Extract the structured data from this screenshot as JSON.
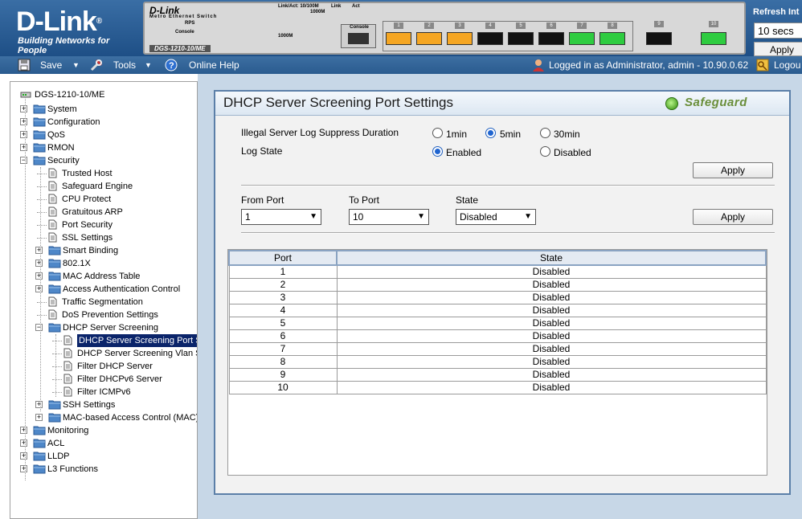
{
  "banner": {
    "brand": "D-Link",
    "tagline": "Building Networks for People",
    "device": {
      "brand": "D-Link",
      "subtitle": "Metro Ethernet Switch",
      "model": "DGS-1210-10/ME",
      "legend_line1": "Link/Act: 10/100M",
      "legend_line2": "1000M",
      "legend_link": "Link",
      "legend_act": "Act",
      "rps_label": "RPS",
      "console_label": "Console",
      "console_port_label": "Console",
      "gig_label": "1000M",
      "port_numbers": [
        "1",
        "2",
        "3",
        "4",
        "5",
        "6",
        "7",
        "8",
        "9",
        "10"
      ],
      "port_colors": [
        "amber",
        "amber",
        "amber",
        "black",
        "black",
        "black",
        "green",
        "green",
        "black",
        "green"
      ]
    },
    "refresh": {
      "label": "Refresh Int",
      "value": "10 secs",
      "apply": "Apply"
    }
  },
  "toolbar": {
    "save": "Save",
    "tools": "Tools",
    "help": "Online Help",
    "login_status": "Logged in as Administrator, admin - 10.90.0.62",
    "logout": "Logou"
  },
  "tree": {
    "root": "DGS-1210-10/ME",
    "items": [
      {
        "label": "System"
      },
      {
        "label": "Configuration"
      },
      {
        "label": "QoS"
      },
      {
        "label": "RMON"
      },
      {
        "label": "Security"
      },
      {
        "label": "Trusted Host"
      },
      {
        "label": "Safeguard Engine"
      },
      {
        "label": "CPU Protect"
      },
      {
        "label": "Gratuitous ARP"
      },
      {
        "label": "Port Security"
      },
      {
        "label": "SSL Settings"
      },
      {
        "label": "Smart Binding"
      },
      {
        "label": "802.1X"
      },
      {
        "label": "MAC Address Table"
      },
      {
        "label": "Access Authentication Control"
      },
      {
        "label": "Traffic Segmentation"
      },
      {
        "label": "DoS Prevention Settings"
      },
      {
        "label": "DHCP Server Screening"
      },
      {
        "label": "DHCP Server Screening Port S"
      },
      {
        "label": "DHCP Server Screening Vlan S"
      },
      {
        "label": "Filter DHCP Server"
      },
      {
        "label": "Filter DHCPv6 Server"
      },
      {
        "label": "Filter ICMPv6"
      },
      {
        "label": "SSH Settings"
      },
      {
        "label": "MAC-based Access Control (MAC)"
      },
      {
        "label": "Monitoring"
      },
      {
        "label": "ACL"
      },
      {
        "label": "LLDP"
      },
      {
        "label": "L3 Functions"
      }
    ]
  },
  "main": {
    "title": "DHCP Server Screening Port Settings",
    "safeguard": "Safeguard",
    "suppress": {
      "label": "Illegal Server Log Suppress Duration",
      "options": [
        "1min",
        "5min",
        "30min"
      ],
      "selected": "5min"
    },
    "log_state": {
      "label": "Log State",
      "options": [
        "Enabled",
        "Disabled"
      ],
      "selected": "Enabled"
    },
    "apply_top": "Apply",
    "from_port": {
      "label": "From Port",
      "value": "1"
    },
    "to_port": {
      "label": "To Port",
      "value": "10"
    },
    "state": {
      "label": "State",
      "value": "Disabled"
    },
    "apply_mid": "Apply",
    "table": {
      "headers": [
        "Port",
        "State"
      ],
      "rows": [
        [
          "1",
          "Disabled"
        ],
        [
          "2",
          "Disabled"
        ],
        [
          "3",
          "Disabled"
        ],
        [
          "4",
          "Disabled"
        ],
        [
          "5",
          "Disabled"
        ],
        [
          "6",
          "Disabled"
        ],
        [
          "7",
          "Disabled"
        ],
        [
          "8",
          "Disabled"
        ],
        [
          "9",
          "Disabled"
        ],
        [
          "10",
          "Disabled"
        ]
      ]
    }
  }
}
